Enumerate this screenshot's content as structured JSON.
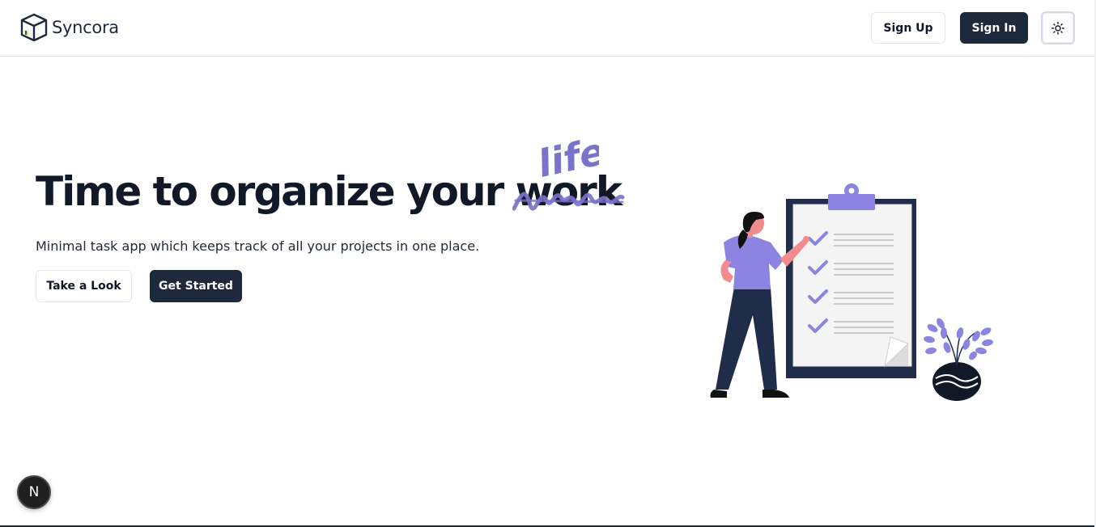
{
  "header": {
    "brand_name": "Syncora",
    "signup_label": "Sign Up",
    "signin_label": "Sign In",
    "theme_icon": "sun-icon"
  },
  "hero": {
    "title_prefix": "Time to organize your ",
    "struck_word": "work",
    "replacement_word": "life",
    "subtitle": "Minimal task app which keeps track of all your projects in one place.",
    "take_look_label": "Take a Look",
    "get_started_label": "Get Started"
  },
  "badge": {
    "letter": "N"
  },
  "colors": {
    "dark": "#1e293b",
    "accent": "#8b84e0",
    "skin": "#f28b8b"
  }
}
